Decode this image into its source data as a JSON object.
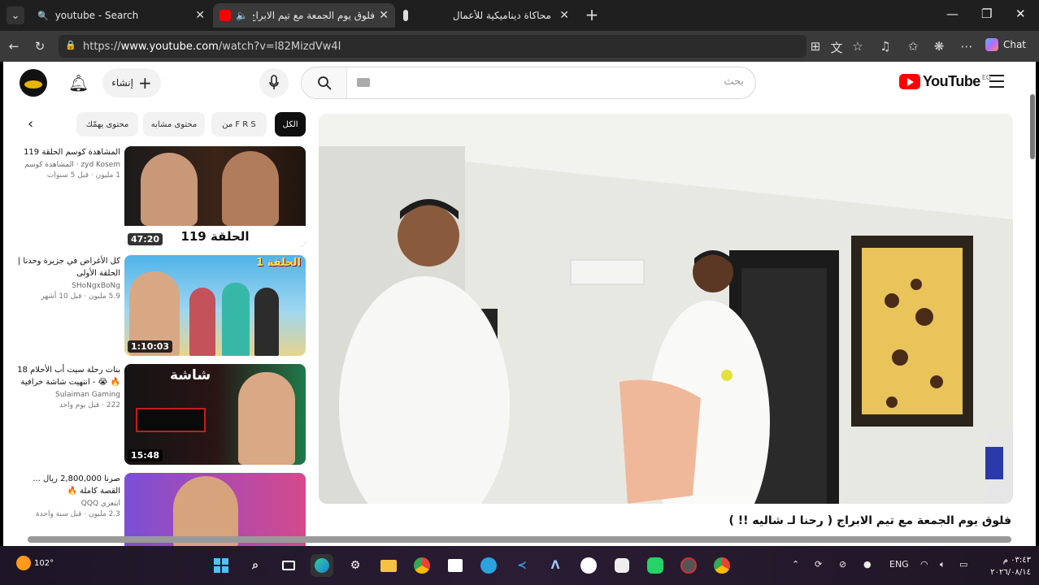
{
  "browser": {
    "tabs": [
      {
        "title": "youtube - Search",
        "active": false
      },
      {
        "title": "فلوق يوم الجمعة مع تيم الابراج",
        "active": true
      },
      {
        "title": "",
        "active": false
      },
      {
        "title": "محاكاة ديناميكية للأعمال",
        "active": false
      }
    ],
    "url_prefix": "https://",
    "url_host": "www.youtube.com",
    "url_path": "/watch?v=l82MizdVw4I",
    "chat_label": "Chat"
  },
  "youtube": {
    "create_label": "إنشاء",
    "search_placeholder": "بحث",
    "logo_text": "YouTube",
    "logo_country": "EG",
    "chips": [
      "الكل",
      "من F R S",
      "محتوى مشابه",
      "محتوى يهمّك"
    ],
    "recommendations": [
      {
        "title": "المشاهدة كوسم الحلقة 119",
        "channel": "zyd Kosem · المشاهدة كوسم",
        "stats": "1 مليون · قبل 5 سنوات",
        "duration": "47:20",
        "thumb_caption": "الحلقة 119",
        "thumb_colors": [
          "#1a1a1a",
          "#6b3d2a"
        ]
      },
      {
        "title": "كل الأغراض في جزيرة وحدنا | الحلقة الأولى",
        "channel": "SHoNgxBoNg",
        "stats": "5.9 مليون · قبل 10 أشهر",
        "duration": "1:10:03",
        "thumb_caption": "الحلقة 1",
        "thumb_colors": [
          "#3aa6e0",
          "#e7d58a"
        ]
      },
      {
        "title": "بنات رحلة سيت أب الأحلام 18 🔥 😭 - انتهيت شاشة خرافية",
        "channel": "Sulaiman Gaming",
        "stats": "222 · قبل يوم واحد",
        "duration": "15:48",
        "thumb_caption": "شاشة",
        "thumb_colors": [
          "#1c1c1c",
          "#c41d1d"
        ]
      },
      {
        "title": "صرنا 2,800,000 ريال ... القصة كاملة 🔥",
        "channel": "ابتعزي QQQ",
        "stats": "2.3 مليون · قبل سنة واحدة",
        "duration": "",
        "thumb_caption": "",
        "thumb_colors": [
          "#7a4fd6",
          "#d44a8c"
        ]
      }
    ],
    "video_title": "فلوق يوم الجمعة مع تيم الابراج ( رحنا لـ شاليه !! )"
  },
  "taskbar": {
    "weather_temp": "102°",
    "lang": "ENG",
    "time": "٠٣:٤٣ م",
    "date": "٢٠٢٦/٠٨/١٤"
  },
  "colors": {
    "youtube_red": "#ff0000",
    "browser_dark": "#1f1f1f",
    "toolbar": "#3a3a3a"
  }
}
